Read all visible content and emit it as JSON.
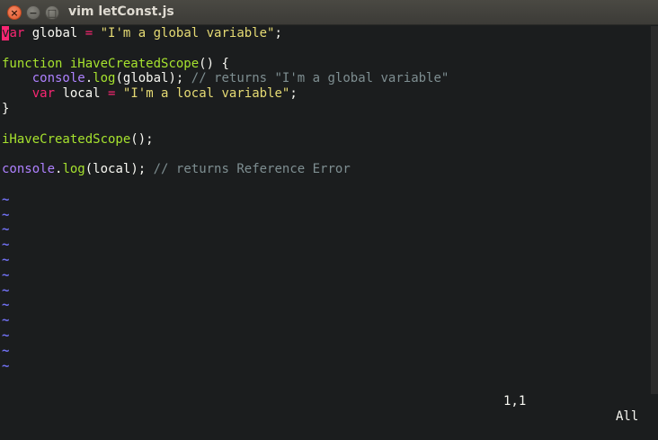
{
  "window": {
    "title": "vim letConst.js",
    "close_glyph": "×",
    "min_glyph": "−",
    "max_glyph": "□"
  },
  "code": {
    "l1": {
      "cursor": "v",
      "kw_rest": "ar",
      "text1": " global ",
      "op": "=",
      "sp": " ",
      "str": "\"I'm a global variable\"",
      "end": ";"
    },
    "l3": {
      "kw": "function",
      "sp": " ",
      "fn": "iHaveCreatedScope",
      "end": "() {"
    },
    "l4": {
      "indent": "    ",
      "obj": "console",
      "dot": ".",
      "fn": "log",
      "args": "(global);",
      "sp": " ",
      "cmt": "// returns \"I'm a global variable\""
    },
    "l5": {
      "indent": "    ",
      "kw": "var",
      "text1": " local ",
      "op": "=",
      "sp": " ",
      "str": "\"I'm a local variable\"",
      "end": ";"
    },
    "l6": {
      "text": "}"
    },
    "l8": {
      "fn": "iHaveCreatedScope",
      "end": "();"
    },
    "l10": {
      "obj": "console",
      "dot": ".",
      "fn": "log",
      "args": "(local);",
      "sp": " ",
      "cmt": "// returns Reference Error"
    }
  },
  "tilde": "~",
  "status": {
    "position": "1,1",
    "percent": "All"
  },
  "colors": {
    "keyword": "#f92672",
    "function": "#a6e22e",
    "object": "#ae81ff",
    "string": "#e6db74",
    "comment": "#7e8e91",
    "tilde": "#7070f0",
    "background": "#1b1d1e"
  }
}
